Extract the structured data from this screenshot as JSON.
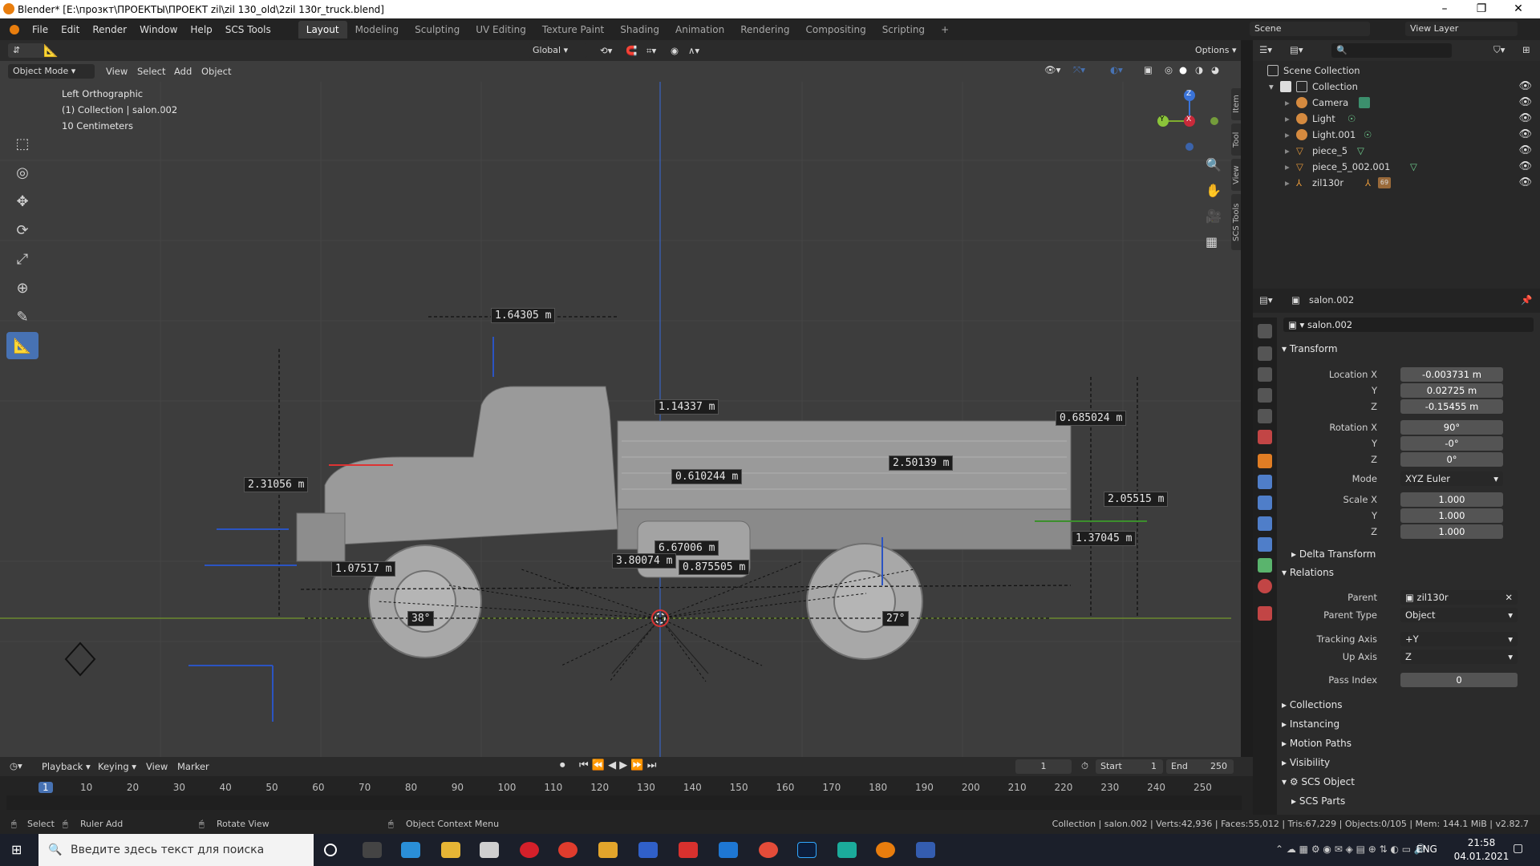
{
  "window": {
    "title": "Blender* [E:\\прозкт\\ПРОЕКТЫ\\ПРОЕКТ zil\\zil 130_old\\2zil 130r_truck.blend]",
    "minimize": "–",
    "maximize": "❐",
    "close": "✕"
  },
  "menu": {
    "items": [
      "File",
      "Edit",
      "Render",
      "Window",
      "Help",
      "SCS Tools"
    ],
    "workspaces": [
      "Layout",
      "Modeling",
      "Sculpting",
      "UV Editing",
      "Texture Paint",
      "Shading",
      "Animation",
      "Rendering",
      "Compositing",
      "Scripting"
    ],
    "add_tab": "+",
    "scene_label": "Scene",
    "view_layer_label": "View Layer"
  },
  "viewport": {
    "mode": "Object Mode",
    "menu": [
      "View",
      "Select",
      "Add",
      "Object"
    ],
    "orientation": "Global",
    "options": "Options",
    "info_view": "Left Orthographic",
    "info_collection": "(1) Collection | salon.002",
    "info_scale": "10 Centimeters",
    "side_tabs": [
      "Item",
      "Tool",
      "View",
      "SCS Tools"
    ],
    "gizmo": {
      "z": "Z",
      "y": "Y",
      "x": "X"
    },
    "measurements": [
      "1.64305 m",
      "1.14337 m",
      "0.685024 m",
      "2.31056 m",
      "0.610244 m",
      "2.50139 m",
      "2.05515 m",
      "6.67006 m",
      "1.37045 m",
      "3.80074 m",
      "0.875505 m",
      "1.07517 m",
      "38°",
      "27°"
    ]
  },
  "timeline": {
    "menu": [
      "Playback",
      "Keying",
      "View",
      "Marker"
    ],
    "current_frame": "1",
    "start_label": "Start",
    "start": "1",
    "end_label": "End",
    "end": "250",
    "ticks": [
      "1",
      "10",
      "20",
      "30",
      "40",
      "50",
      "60",
      "70",
      "80",
      "90",
      "100",
      "110",
      "120",
      "130",
      "140",
      "150",
      "160",
      "170",
      "180",
      "190",
      "200",
      "210",
      "220",
      "230",
      "240",
      "250"
    ]
  },
  "status": {
    "select": "Select",
    "ruler": "Ruler Add",
    "rotate": "Rotate View",
    "context": "Object Context Menu",
    "stats": "Collection | salon.002 | Verts:42,936 | Faces:55,012 | Tris:67,229 | Objects:0/105 | Mem: 144.1 MiB | v2.82.7"
  },
  "outliner": {
    "root": "Scene Collection",
    "collection": "Collection",
    "items": [
      "Camera",
      "Light",
      "Light.001",
      "piece_5",
      "piece_5_002.001",
      "zil130r"
    ],
    "zil_badge": "69"
  },
  "properties": {
    "object_name": "salon.002",
    "datablock": "salon.002",
    "transform_header": "Transform",
    "location": {
      "label_x": "Location X",
      "x": "-0.003731 m",
      "y": "0.02725 m",
      "z": "-0.15455 m"
    },
    "rotation": {
      "label_x": "Rotation X",
      "x": "90°",
      "y": "-0°",
      "z": "0°"
    },
    "mode_label": "Mode",
    "mode": "XYZ Euler",
    "scale": {
      "label_x": "Scale X",
      "x": "1.000",
      "y": "1.000",
      "z": "1.000"
    },
    "axis_y": "Y",
    "axis_z": "Z",
    "delta": "Delta Transform",
    "relations_header": "Relations",
    "parent_label": "Parent",
    "parent": "zil130r",
    "parent_type_label": "Parent Type",
    "parent_type": "Object",
    "tracking_label": "Tracking Axis",
    "tracking": "+Y",
    "up_label": "Up Axis",
    "up": "Z",
    "pass_label": "Pass Index",
    "pass": "0",
    "collapsed": [
      "Collections",
      "Instancing",
      "Motion Paths",
      "Visibility"
    ],
    "scs_object": "SCS Object",
    "scs_parts": "SCS Parts"
  },
  "taskbar": {
    "search_placeholder": "Введите здесь текст для поиска",
    "lang": "ENG",
    "time": "21:58",
    "date": "04.01.2021"
  }
}
